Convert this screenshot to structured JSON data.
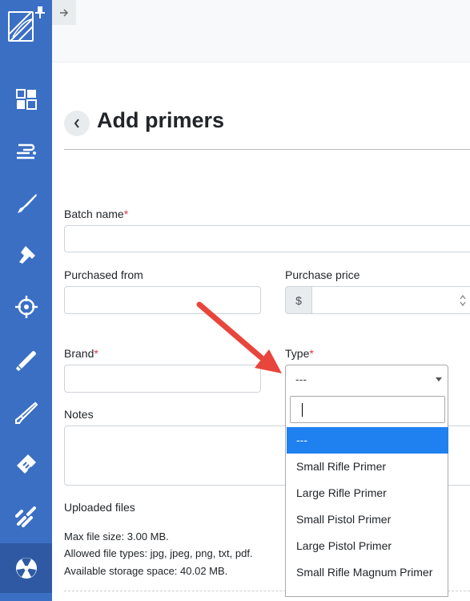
{
  "sidebar": {
    "items": [
      {
        "icon": "dashboard-icon"
      },
      {
        "icon": "components-icon"
      },
      {
        "icon": "rifle-icon"
      },
      {
        "icon": "pistol-icon"
      },
      {
        "icon": "target-icon"
      },
      {
        "icon": "cartridge-icon"
      },
      {
        "icon": "cleaning-rod-icon"
      },
      {
        "icon": "ammo-box-icon"
      },
      {
        "icon": "bullets-icon"
      },
      {
        "icon": "powder-icon"
      }
    ],
    "active_index": 9
  },
  "header": {
    "title": "Add primers"
  },
  "form": {
    "batch_name_label": "Batch name",
    "purchased_from_label": "Purchased from",
    "purchase_price_label": "Purchase price",
    "currency_symbol": "$",
    "brand_label": "Brand",
    "type_label": "Type",
    "required_marker": "*",
    "notes_label": "Notes",
    "type_select": {
      "value": "---",
      "options": [
        "---",
        "Small Rifle Primer",
        "Large Rifle Primer",
        "Small Pistol Primer",
        "Large Pistol Primer",
        "Small Rifle Magnum Primer"
      ],
      "highlighted_index": 0
    },
    "uploaded_files_label": "Uploaded files",
    "max_file_size": "Max file size: 3.00 MB.",
    "allowed_types": "Allowed file types: jpg, jpeg, png, txt, pdf.",
    "storage": "Available storage space: 40.02 MB."
  },
  "colors": {
    "sidebar": "#3a6fc4",
    "required": "#dc3545",
    "highlight": "#1f80f0",
    "annotation_arrow": "#e8453c"
  }
}
